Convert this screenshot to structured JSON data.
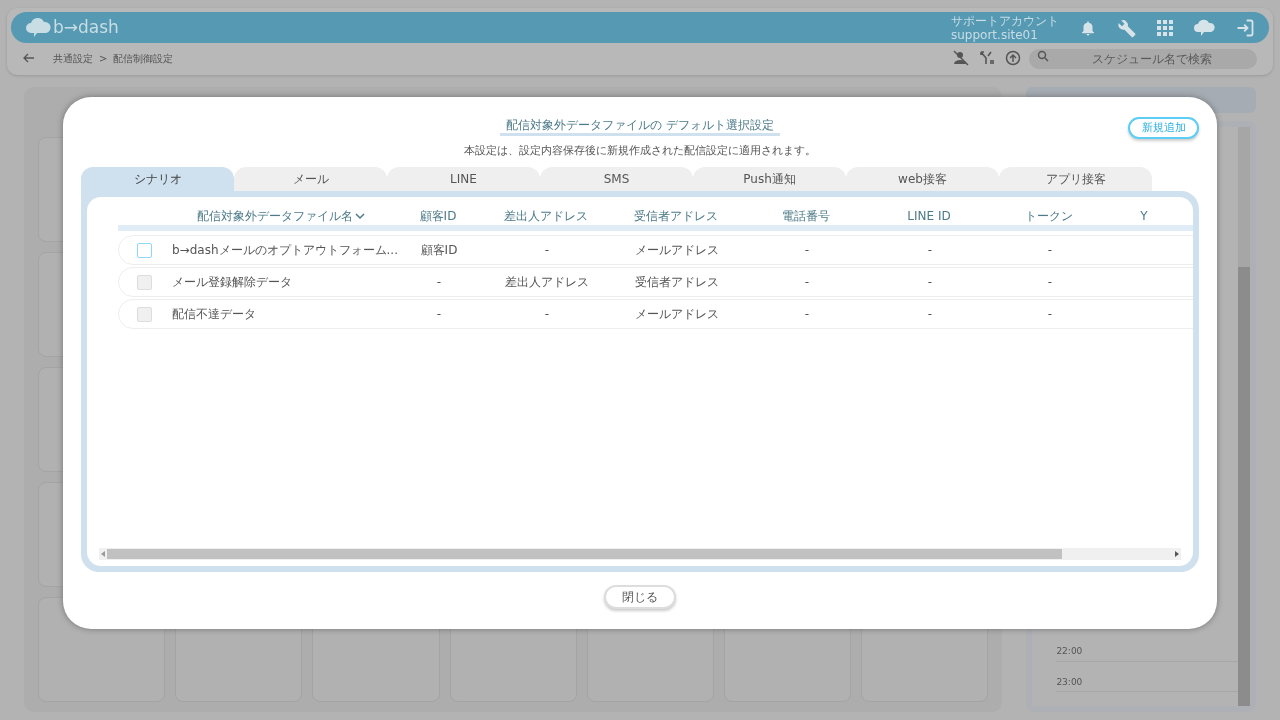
{
  "header": {
    "logo": "b→dash",
    "account_name": "サポートアカウント",
    "account_id": "support.site01"
  },
  "breadcrumb": [
    "共通設定",
    "配信制御設定"
  ],
  "breadcrumb_separator": ">",
  "search": {
    "placeholder": "スケジュール名で検索"
  },
  "calendar_times": [
    "22:00",
    "23:00"
  ],
  "modal": {
    "title": "配信対象外データファイルの デフォルト選択設定",
    "subtitle": "本設定は、設定内容保存後に新規作成された配信設定に適用されます。",
    "add_button": "新規追加",
    "close_button": "閉じる",
    "tabs": [
      {
        "label": "シナリオ",
        "selected": true
      },
      {
        "label": "メール",
        "selected": false
      },
      {
        "label": "LINE",
        "selected": false
      },
      {
        "label": "SMS",
        "selected": false
      },
      {
        "label": "Push通知",
        "selected": false
      },
      {
        "label": "web接客",
        "selected": false
      },
      {
        "label": "アプリ接客",
        "selected": false
      }
    ],
    "table": {
      "columns": [
        "配信対象外データファイル名",
        "顧客ID",
        "差出人アドレス",
        "受信者アドレス",
        "電話番号",
        "LINE ID",
        "トークン",
        "Y"
      ],
      "rows": [
        {
          "checked": false,
          "disabled": false,
          "cells": [
            "b→dashメールのオプトアウトフォーム...",
            "顧客ID",
            "-",
            "メールアドレス",
            "-",
            "-",
            "-"
          ]
        },
        {
          "checked": false,
          "disabled": true,
          "cells": [
            "メール登録解除データ",
            "-",
            "差出人アドレス",
            "受信者アドレス",
            "-",
            "-",
            "-"
          ]
        },
        {
          "checked": false,
          "disabled": true,
          "cells": [
            "配信不達データ",
            "-",
            "-",
            "メールアドレス",
            "-",
            "-",
            "-"
          ]
        }
      ]
    }
  }
}
